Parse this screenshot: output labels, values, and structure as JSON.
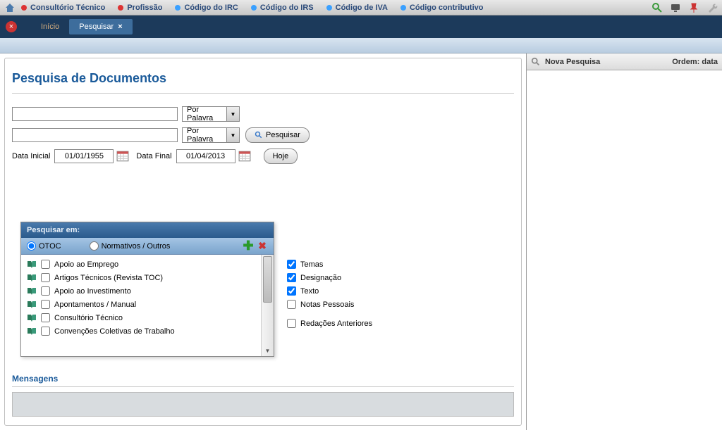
{
  "topmenu": {
    "items": [
      {
        "label": "Consultório Técnico",
        "dot": "red"
      },
      {
        "label": "Profissão",
        "dot": "red"
      },
      {
        "label": "Código do IRC",
        "dot": "blue"
      },
      {
        "label": "Código do IRS",
        "dot": "blue"
      },
      {
        "label": "Código de IVA",
        "dot": "blue"
      },
      {
        "label": "Código contributivo",
        "dot": "blue"
      }
    ]
  },
  "tabs": {
    "inicio": "Início",
    "pesquisar": "Pesquisar"
  },
  "page": {
    "title": "Pesquisa de Documentos",
    "select1": "Por Palavra",
    "select2": "Por Palavra",
    "search_btn": "Pesquisar",
    "date_start_label": "Data Inicial",
    "date_start_value": "01/01/1955",
    "date_end_label": "Data Final",
    "date_end_value": "01/04/2013",
    "hoje_btn": "Hoje"
  },
  "panel": {
    "head": "Pesquisar em:",
    "radio_otoc": "OTOC",
    "radio_norm": "Normativos / Outros",
    "items": [
      "Apoio ao Emprego",
      "Artigos Técnicos (Revista TOC)",
      "Apoio ao Investimento",
      "Apontamentos / Manual",
      "Consultório Técnico",
      "Convenções Coletivas de Trabalho"
    ]
  },
  "checks": {
    "temas": "Temas",
    "designacao": "Designação",
    "texto": "Texto",
    "notas": "Notas Pessoais",
    "redacoes": "Redações Anteriores"
  },
  "messages": {
    "title": "Mensagens"
  },
  "side": {
    "title": "Nova Pesquisa",
    "order": "Ordem: data"
  }
}
